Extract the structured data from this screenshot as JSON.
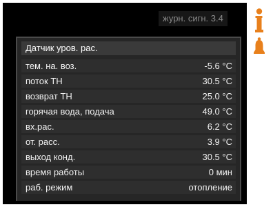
{
  "header": {
    "title": "журн. сигн. 3.4"
  },
  "panel": {
    "title": "Датчик уров. рас.",
    "rows": [
      {
        "label": "тем. на. воз.",
        "value": "-5.6  °C"
      },
      {
        "label": "поток ТН",
        "value": "30.5  °C"
      },
      {
        "label": "возврат ТН",
        "value": "25.0  °C"
      },
      {
        "label": "горячая вода, подача",
        "value": "49.0  °C"
      },
      {
        "label": "вх.рас.",
        "value": "6.2 °C"
      },
      {
        "label": "от. расс.",
        "value": "3.9 °C"
      },
      {
        "label": "выход конд.",
        "value": "30.5 °C"
      },
      {
        "label": "время работы",
        "value": "0 мин"
      },
      {
        "label": "раб. режим",
        "value": "отопление"
      }
    ]
  },
  "icons": {
    "info": "info-icon",
    "alarm": "bell-icon",
    "accent_color": "#e8801c"
  }
}
